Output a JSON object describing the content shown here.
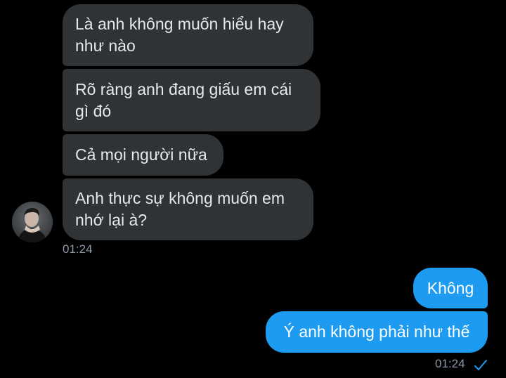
{
  "messages_in": [
    {
      "text": "Là anh không muốn hiểu hay như nào"
    },
    {
      "text": "Rõ ràng anh đang giấu em cái gì đó"
    },
    {
      "text": "Cả mọi người nữa"
    },
    {
      "text": "Anh thực sự không muốn em nhớ lại à?"
    }
  ],
  "incoming_time": "01:24",
  "messages_out": [
    {
      "text": "Không"
    },
    {
      "text": "Ý anh không phải như thế"
    }
  ],
  "outgoing_time": "01:24",
  "avatar_icon": "user-avatar-photo",
  "read_icon": "checkmark-icon",
  "colors": {
    "background": "#000000",
    "incoming_bubble": "#2f3336",
    "outgoing_bubble": "#1d9bf0",
    "timestamp": "#8b98a5"
  }
}
